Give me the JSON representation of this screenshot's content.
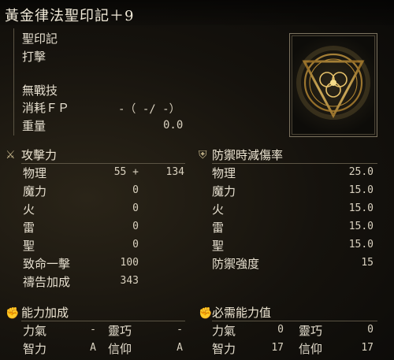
{
  "item": {
    "name": "黃金律法聖印記＋9",
    "type": "聖印記",
    "attack_type": "打擊",
    "skill": "無戰技",
    "fp_label": "消耗ＦＰ",
    "fp_value": "-（ -/ -）",
    "weight_label": "重量",
    "weight_value": "0.0",
    "icon": "golden-order-seal-icon"
  },
  "attack": {
    "title": "攻擊力",
    "icon": "sword-icon",
    "rows": [
      {
        "label": "物理",
        "value": "55 +",
        "extra": "134"
      },
      {
        "label": "魔力",
        "value": "0"
      },
      {
        "label": "火",
        "value": "0"
      },
      {
        "label": "雷",
        "value": "0"
      },
      {
        "label": "聖",
        "value": "0"
      },
      {
        "label": "致命一擊",
        "value": "100"
      },
      {
        "label": "禱告加成",
        "value": "343"
      }
    ]
  },
  "guard": {
    "title": "防禦時減傷率",
    "icon": "shield-icon",
    "rows": [
      {
        "label": "物理",
        "value": "25.0"
      },
      {
        "label": "魔力",
        "value": "15.0"
      },
      {
        "label": "火",
        "value": "15.0"
      },
      {
        "label": "雷",
        "value": "15.0"
      },
      {
        "label": "聖",
        "value": "15.0"
      },
      {
        "label": "防禦強度",
        "value": "15"
      }
    ]
  },
  "scaling": {
    "title": "能力加成",
    "icon": "arm-icon",
    "rows": [
      {
        "l1": "力氣",
        "v1": "-",
        "l2": "靈巧",
        "v2": "-"
      },
      {
        "l1": "智力",
        "v1": "A",
        "l2": "信仰",
        "v2": "A"
      }
    ]
  },
  "requirements": {
    "title": "必需能力值",
    "icon": "arm-icon",
    "rows": [
      {
        "l1": "力氣",
        "v1": "0",
        "l2": "靈巧",
        "v2": "0"
      },
      {
        "l1": "智力",
        "v1": "17",
        "l2": "信仰",
        "v2": "17"
      }
    ]
  },
  "colors": {
    "accent": "#c9a24a",
    "text": "#e6dfcf",
    "rule": "#5b5444"
  }
}
